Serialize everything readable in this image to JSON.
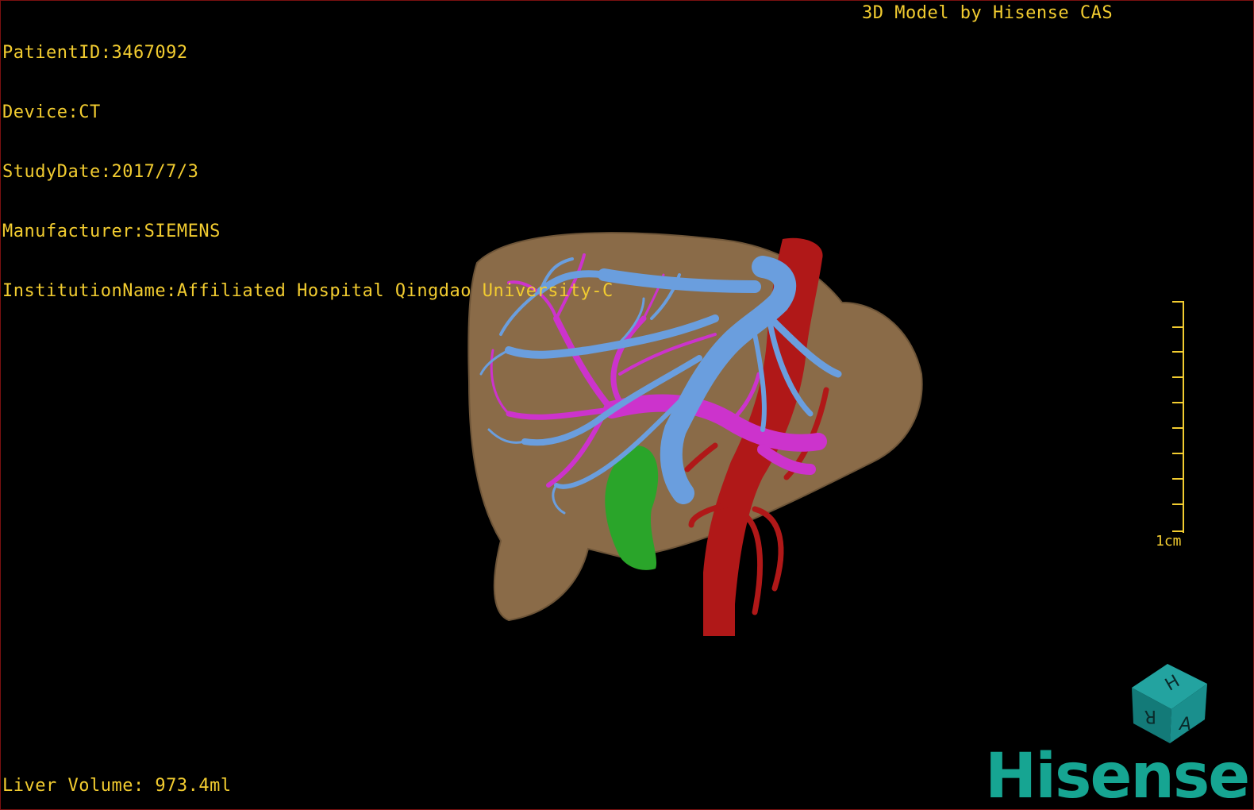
{
  "viewer": {
    "patient_id": "PatientID:3467092",
    "device": "Device:CT",
    "study_date": "StudyDate:2017/7/3",
    "manufacturer": "Manufacturer:SIEMENS",
    "institution": "InstitutionName:Affiliated Hospital Qingdao University-C",
    "title_label": "3D Model by Hisense CAS",
    "liver_volume": "Liver Volume: 973.4ml",
    "scale_label": "1cm",
    "brand": "Hisense",
    "orientation_cube_labels": [
      "H",
      "R",
      "A"
    ]
  },
  "colors": {
    "overlay_text": "#f2cc30",
    "liver": "#8a6b48",
    "portal_vein": "#6a9ede",
    "hepatic_vein": "#cc33cc",
    "artery": "#b01818",
    "gallbladder": "#2aa52a",
    "brand": "#16a592",
    "cube": "#1a8a88"
  }
}
